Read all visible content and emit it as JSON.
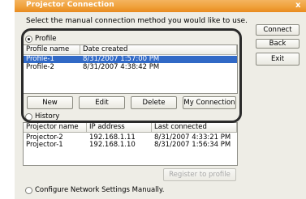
{
  "window": {
    "title": "Projector Connection",
    "close_glyph": "x"
  },
  "instruction": "Select the manual connection method you would like to use.",
  "side_buttons": {
    "connect": "Connect",
    "back": "Back",
    "exit": "Exit"
  },
  "profile": {
    "radio_label": "Profile",
    "selected": true,
    "columns": [
      "Profile name",
      "Date created"
    ],
    "rows": [
      {
        "name": "Profile-1",
        "date": "8/31/2007 1:57:00 PM",
        "selected": true
      },
      {
        "name": "Profile-2",
        "date": "8/31/2007 4:38:42 PM",
        "selected": false
      }
    ],
    "buttons": {
      "new": "New",
      "edit": "Edit",
      "delete": "Delete",
      "my_connection": "My Connection"
    }
  },
  "history": {
    "radio_label": "History",
    "selected": false,
    "columns": [
      "Projector name",
      "IP address",
      "Last connected"
    ],
    "rows": [
      {
        "name": "Projector-2",
        "ip": "192.168.1.11",
        "last": "8/31/2007 4:33:21 PM"
      },
      {
        "name": "Projector-1",
        "ip": "192.168.1.10",
        "last": "8/31/2007 1:56:34 PM"
      }
    ],
    "register_button": "Register to profile"
  },
  "configure_manual": {
    "radio_label": "Configure Network Settings Manually.",
    "selected": false
  },
  "colors": {
    "title_bar": "#f0a23c",
    "selection": "#3169c6",
    "highlight_frame": "#2a2a2a"
  }
}
